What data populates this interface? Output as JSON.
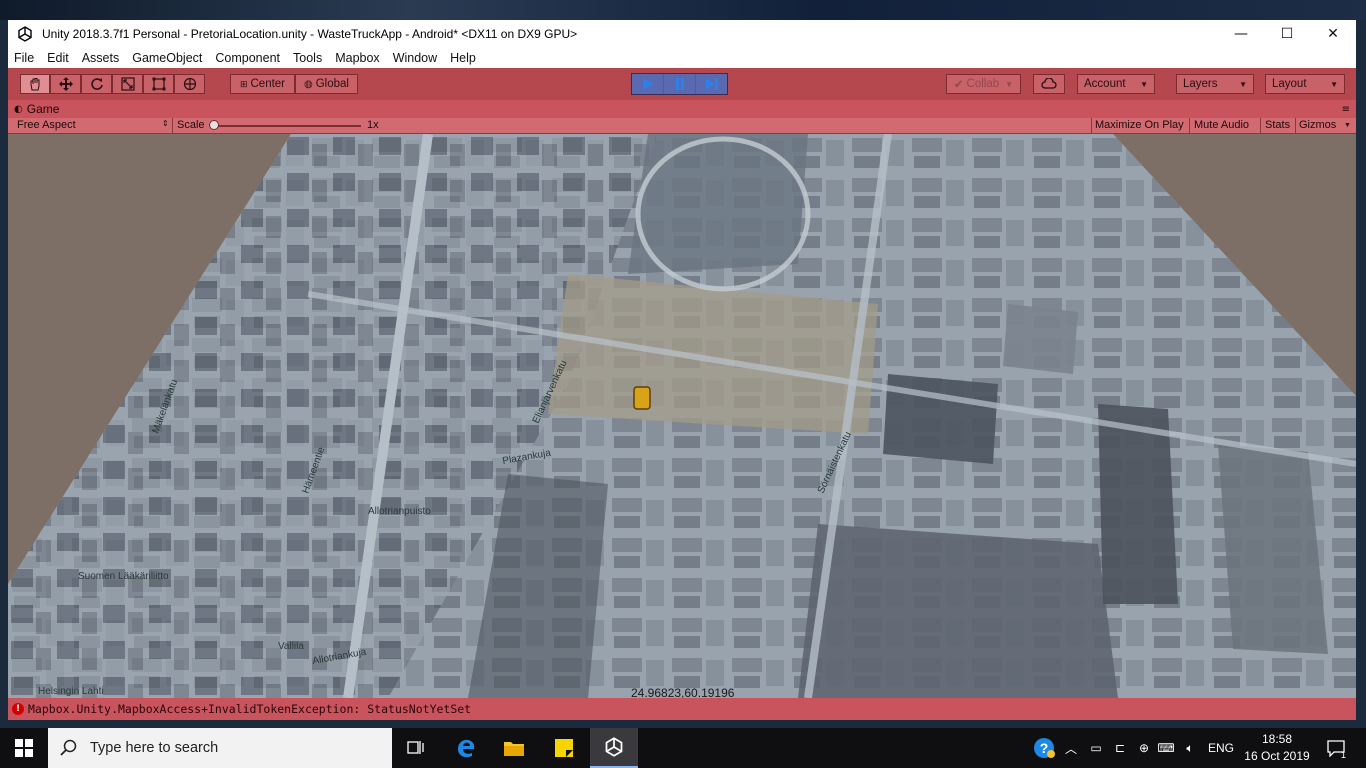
{
  "window": {
    "title": "Unity 2018.3.7f1 Personal - PretoriaLocation.unity - WasteTruckApp - Android* <DX11 on DX9 GPU>",
    "controls": {
      "minimize": "—",
      "maximize": "☐",
      "close": "✕"
    }
  },
  "menu": [
    "File",
    "Edit",
    "Assets",
    "GameObject",
    "Component",
    "Tools",
    "Mapbox",
    "Window",
    "Help"
  ],
  "toolbar": {
    "pivot": "Center",
    "space": "Global",
    "collab": "Collab",
    "account": "Account",
    "layers": "Layers",
    "layout": "Layout"
  },
  "game_view": {
    "tab_label": "Game",
    "aspect": "Free Aspect",
    "scale_label": "Scale",
    "scale_value": "1x",
    "scale_level": 0,
    "maximize_on_play": "Maximize On Play",
    "mute_audio": "Mute Audio",
    "stats": "Stats",
    "gizmos": "Gizmos",
    "coords": "24.96823,60.19196"
  },
  "map_labels": [
    "Mäkelänkatu",
    "Hämeentie",
    "Allotrianpuisto",
    "Allotriankuja",
    "Vallila",
    "Elianjarvenkatu",
    "Plazankuja",
    "Sörnäistenkatu",
    "Suomen Lääkäriliitto",
    "Helsingin Lahti"
  ],
  "status": {
    "message": "Mapbox.Unity.MapboxAccess+InvalidTokenException: StatusNotYetSet"
  },
  "taskbar": {
    "search_placeholder": "Type here to search",
    "language": "ENG",
    "time": "18:58",
    "date": "16 Oct 2019",
    "notification_count": "1"
  },
  "colors": {
    "play_mode_tint": "#b5474f",
    "error": "#d40000",
    "taskbar": "#0f0f11"
  }
}
